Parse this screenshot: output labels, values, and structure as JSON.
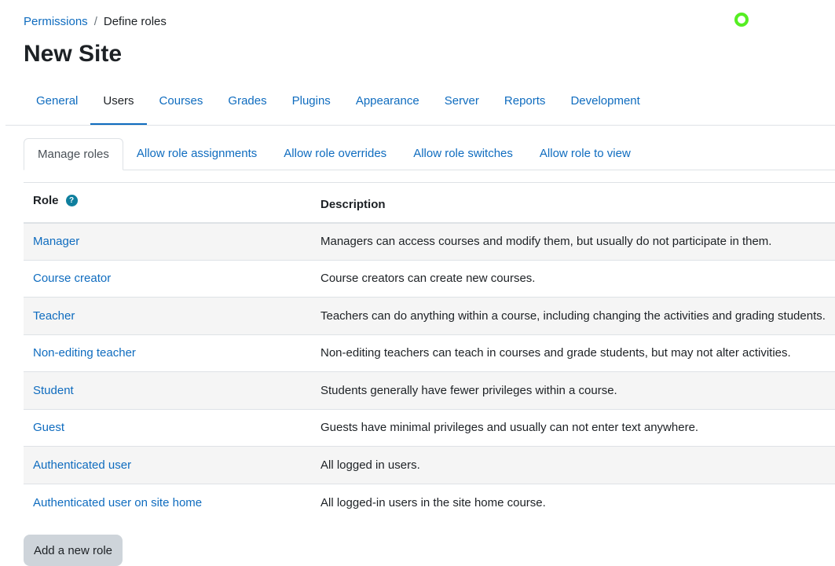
{
  "breadcrumb": {
    "parent": "Permissions",
    "separator": "/",
    "current": "Define roles"
  },
  "page_title": "New Site",
  "primary_tabs": [
    {
      "label": "General"
    },
    {
      "label": "Users",
      "active": true
    },
    {
      "label": "Courses"
    },
    {
      "label": "Grades"
    },
    {
      "label": "Plugins"
    },
    {
      "label": "Appearance"
    },
    {
      "label": "Server"
    },
    {
      "label": "Reports"
    },
    {
      "label": "Development"
    }
  ],
  "secondary_tabs": [
    {
      "label": "Manage roles",
      "active": true
    },
    {
      "label": "Allow role assignments"
    },
    {
      "label": "Allow role overrides"
    },
    {
      "label": "Allow role switches"
    },
    {
      "label": "Allow role to view"
    }
  ],
  "table": {
    "headers": {
      "role": "Role",
      "description": "Description",
      "help_icon": "?"
    },
    "rows": [
      {
        "role": "Manager",
        "description": "Managers can access courses and modify them, but usually do not participate in them."
      },
      {
        "role": "Course creator",
        "description": "Course creators can create new courses."
      },
      {
        "role": "Teacher",
        "description": "Teachers can do anything within a course, including changing the activities and grading students."
      },
      {
        "role": "Non-editing teacher",
        "description": "Non-editing teachers can teach in courses and grade students, but may not alter activities."
      },
      {
        "role": "Student",
        "description": "Students generally have fewer privileges within a course."
      },
      {
        "role": "Guest",
        "description": "Guests have minimal privileges and usually can not enter text anywhere."
      },
      {
        "role": "Authenticated user",
        "description": "All logged in users."
      },
      {
        "role": "Authenticated user on site home",
        "description": "All logged-in users in the site home course."
      }
    ]
  },
  "add_button": "Add a new role",
  "colors": {
    "link": "#0f6cbf",
    "active_underline": "#0f6cbf",
    "help_icon": "#0f7f9e",
    "cursor_ring": "#55ee22"
  }
}
